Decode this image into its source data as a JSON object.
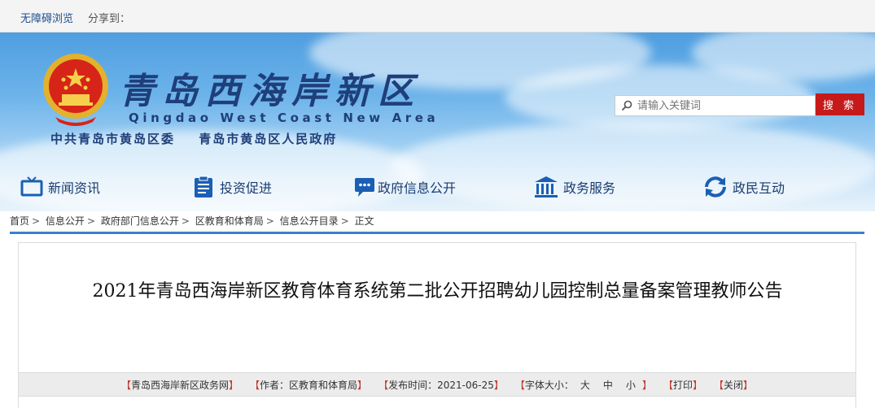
{
  "topbar": {
    "accessibility": "无障碍浏览",
    "share": "分享到："
  },
  "header": {
    "site_name": "青岛西海岸新区",
    "site_name_en": "Qingdao West Coast New Area",
    "party": "中共青岛市黄岛区委",
    "government": "青岛市黄岛区人民政府"
  },
  "search": {
    "placeholder": "请输入关键词",
    "button": "搜 索"
  },
  "nav": [
    {
      "label": "新闻资讯",
      "icon": "tv-icon"
    },
    {
      "label": "投资促进",
      "icon": "clipboard-icon"
    },
    {
      "label": "政府信息公开",
      "icon": "chat-bubble-icon"
    },
    {
      "label": "政务服务",
      "icon": "government-building-icon"
    },
    {
      "label": "政民互动",
      "icon": "refresh-arrows-icon"
    }
  ],
  "breadcrumb": [
    "首页",
    "信息公开",
    "政府部门信息公开",
    "区教育和体育局",
    "信息公开目录",
    "正文"
  ],
  "article": {
    "title": "2021年青岛西海岸新区教育体育系统第二批公开招聘幼儿园控制总量备案管理教师公告",
    "source": "青岛西海岸新区政务网",
    "author_label": "作者：",
    "author": "区教育和体育局",
    "date_label": "发布时间：",
    "date": "2021-06-25",
    "font_size_label": "字体大小：",
    "font_sizes": [
      "大",
      "中",
      "小"
    ],
    "print": "打印",
    "close": "关闭"
  },
  "colors": {
    "brand": "#1f3f7a",
    "accent_red": "#c61a1a",
    "frame_blue": "#3b7fd0"
  }
}
